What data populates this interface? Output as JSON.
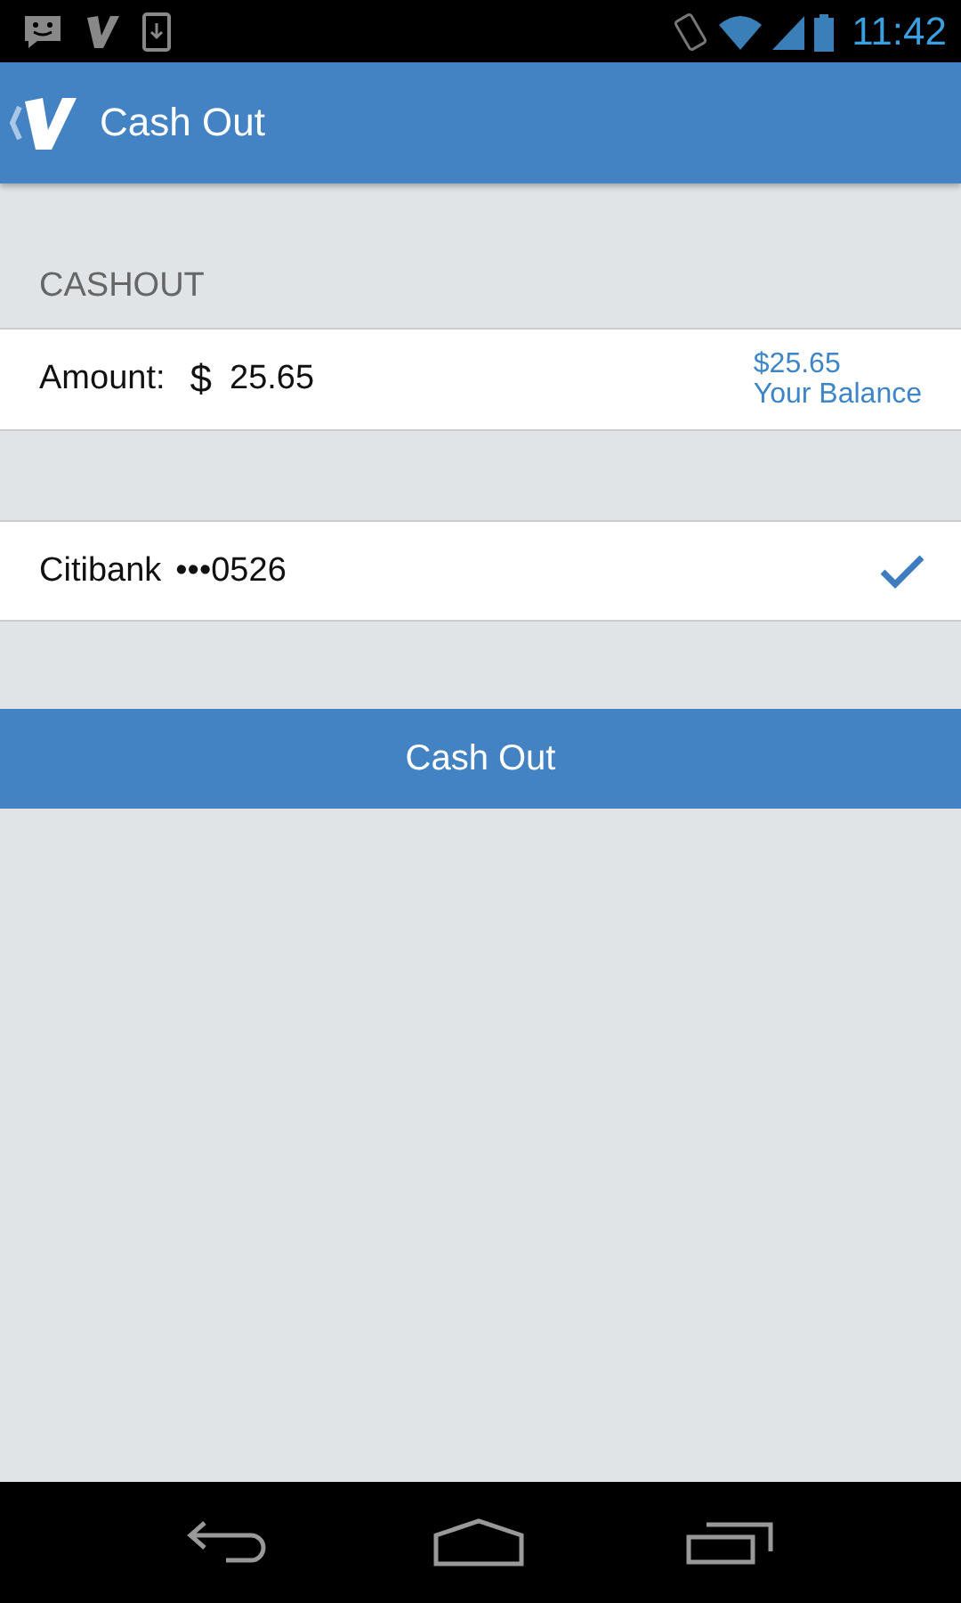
{
  "status_bar": {
    "time": "11:42"
  },
  "app_bar": {
    "title": "Cash Out"
  },
  "section_header": "CASHOUT",
  "amount": {
    "label": "Amount:",
    "currency": "$",
    "value": "25.65",
    "balance": "$25.65",
    "balance_label": "Your Balance"
  },
  "accounts": [
    {
      "name": "Citibank",
      "number": "•••0526",
      "selected": true
    }
  ],
  "button": "Cash Out"
}
